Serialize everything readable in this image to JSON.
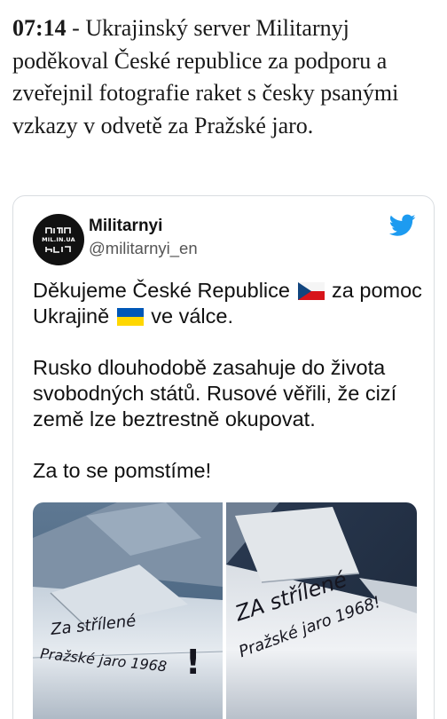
{
  "article": {
    "time": "07:14",
    "text": " - Ukrajinský server Militarnyj poděkoval České republice za podporu a zveřejnil fotografie raket s česky psanými vzkazy v odvetě za Pražské jaro."
  },
  "tweet": {
    "avatar_text": "MIL.IN.UA",
    "display_name": "Militarnyi",
    "handle": "@militarnyi_en",
    "line1a": "Děkujeme České Republice ",
    "line1b": " za pomoc Ukrajině ",
    "line1c": " ve válce.",
    "para2": "Rusko dlouhodobě zasahuje do života svobodných států. Rusové věřili, že cizí země lze beztrestně okupovat.",
    "para3": "Za to se pomstíme!",
    "icons": {
      "twitter": "twitter-bird-icon",
      "flag_cz": "czech-flag-icon",
      "flag_ua": "ukraine-flag-icon"
    },
    "colors": {
      "twitter_blue": "#1d9bf0"
    }
  },
  "photos": {
    "left": {
      "line1": "Za střílené",
      "line2": "Pražské jaro 1968",
      "mark": "!"
    },
    "right": {
      "line1": "ZA střílené",
      "line2": "Pražské jaro 1968!"
    }
  }
}
